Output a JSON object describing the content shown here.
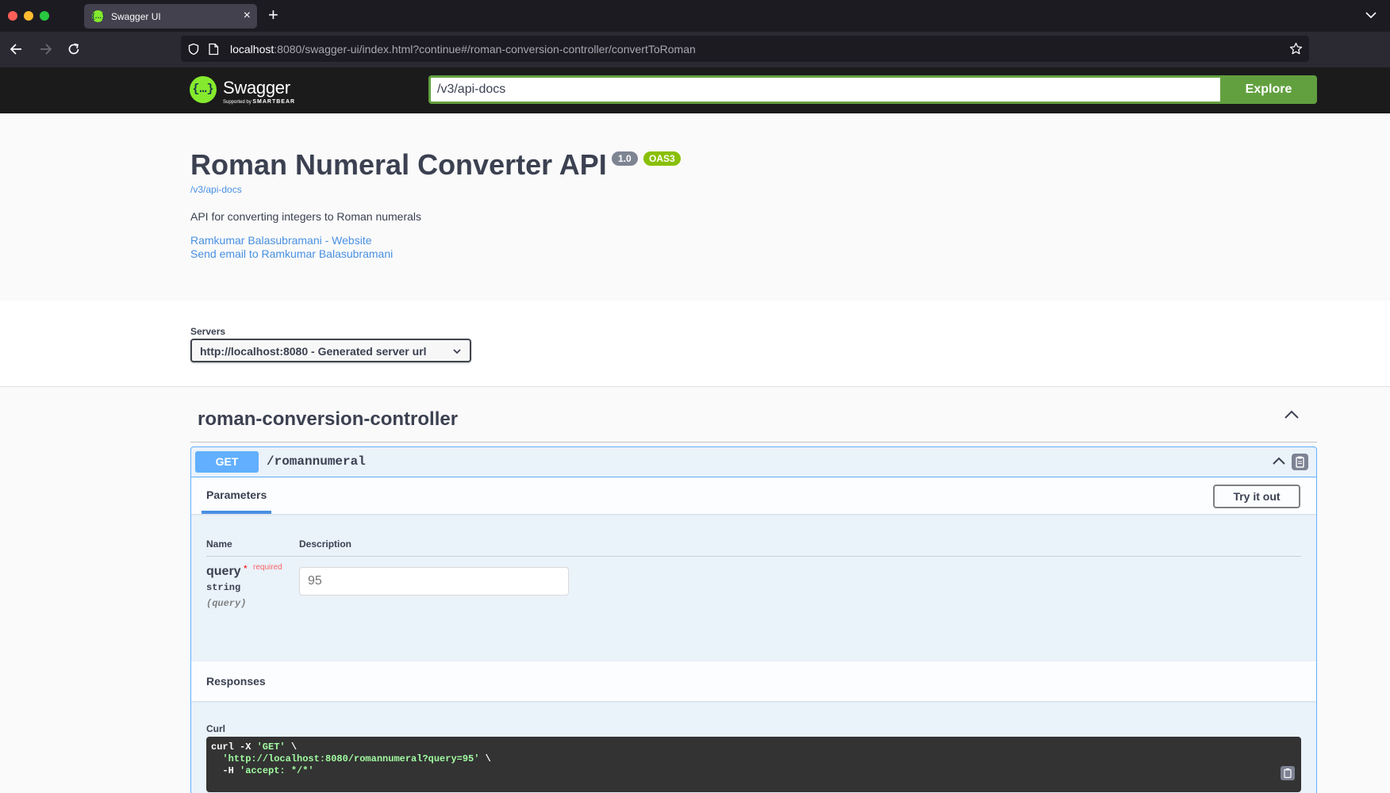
{
  "browser": {
    "tab_title": "Swagger UI",
    "url_host": "localhost",
    "url_rest": ":8080/swagger-ui/index.html?continue#/roman-conversion-controller/convertToRoman",
    "tab_favicon_glyph": "{…}"
  },
  "topbar": {
    "logo_glyph": "{…}",
    "logo_name": "Swagger",
    "logo_sub_prefix": "Supported by ",
    "logo_sub_brand": "SMARTBEAR",
    "spec_url": "/v3/api-docs",
    "explore_label": "Explore"
  },
  "info": {
    "title": "Roman Numeral Converter API",
    "version": "1.0",
    "oas": "OAS3",
    "spec_link": "/v3/api-docs",
    "description": "API for converting integers to Roman numerals",
    "contact_website": "Ramkumar Balasubramani - Website",
    "contact_email": "Send email to Ramkumar Balasubramani"
  },
  "servers": {
    "label": "Servers",
    "selected": "http://localhost:8080 - Generated server url"
  },
  "tag": {
    "name": "roman-conversion-controller"
  },
  "operation": {
    "method": "GET",
    "path": "/romannumeral",
    "params_tab": "Parameters",
    "try_label": "Try it out",
    "col_name": "Name",
    "col_description": "Description",
    "param": {
      "name": "query",
      "star": "*",
      "required": "required",
      "type": "string",
      "in": "(query)",
      "value": "95"
    },
    "responses_title": "Responses",
    "curl_label": "Curl",
    "curl": {
      "l1_cmd": "curl -X ",
      "l1_str": "'GET'",
      "l1_tail": " \\",
      "l2_indent": "  ",
      "l2_str": "'http://localhost:8080/romannumeral?query=95'",
      "l2_tail": " \\",
      "l3_cmd": "  -H ",
      "l3_str": "'accept: */*'"
    }
  },
  "colors": {
    "swagger_green": "#85ea2d",
    "explore_green": "#62a03f",
    "get_blue": "#61affe",
    "link_blue": "#4990e2",
    "oas_badge": "#89bf04",
    "text_dark": "#3b4151"
  }
}
